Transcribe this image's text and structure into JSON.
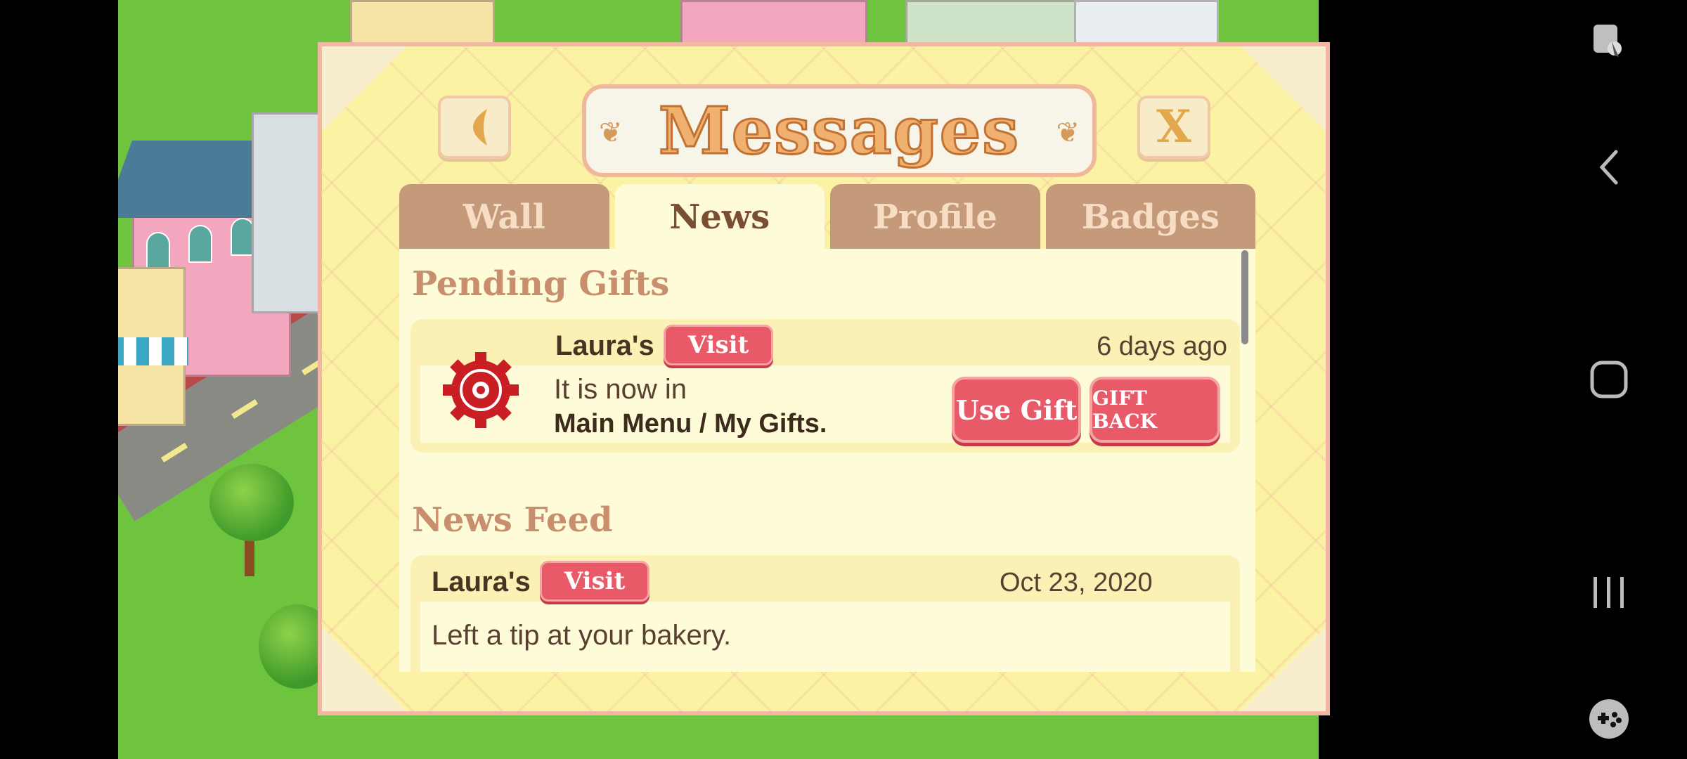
{
  "dialog": {
    "title": "Messages",
    "close_label": "X"
  },
  "tabs": [
    {
      "label": "Wall",
      "active": false
    },
    {
      "label": "News",
      "active": true
    },
    {
      "label": "Profile",
      "active": false
    },
    {
      "label": "Badges",
      "active": false
    }
  ],
  "pending_gifts": {
    "heading": "Pending Gifts",
    "item": {
      "name": "Laura's",
      "visit_label": "Visit",
      "time": "6 days ago",
      "line1": "It is now in",
      "line2": "Main Menu / My Gifts.",
      "use_gift_label": "Use Gift",
      "gift_back_label": "GIFT BACK",
      "icon": "gear-icon"
    }
  },
  "news_feed": {
    "heading": "News Feed",
    "item": {
      "name": "Laura's",
      "visit_label": "Visit",
      "date": "Oct 23, 2020",
      "message": "Left a tip at your bakery."
    }
  },
  "navbar": {
    "icons": [
      "screen-control-icon",
      "back-icon",
      "home-icon",
      "recents-icon",
      "game-tools-icon"
    ]
  },
  "colors": {
    "accent_red": "#e85a68",
    "dialog_bg": "#fbf3a3",
    "tab_inactive": "#c49a7a"
  }
}
